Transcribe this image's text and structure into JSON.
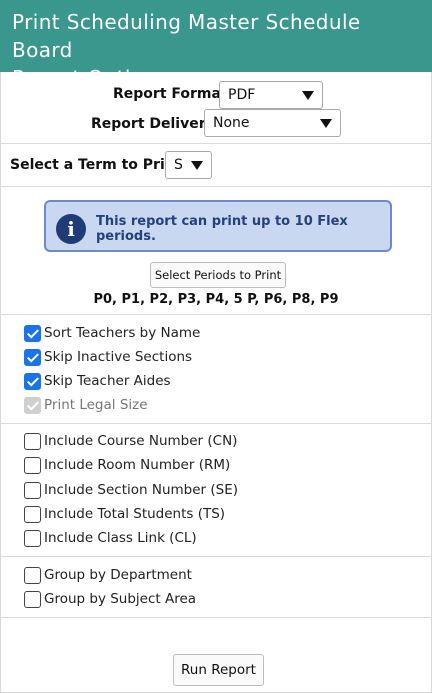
{
  "header": {
    "title_line1": "Print Scheduling Master Schedule Board",
    "title_line2": "Report Options"
  },
  "report": {
    "format_label": "Report Format:",
    "format_value": "PDF",
    "delivery_label": "Report Delivery:",
    "delivery_value": "None"
  },
  "term": {
    "label": "Select a Term to Print:",
    "value": "S"
  },
  "info": {
    "icon": "info-icon",
    "message": "This report can print up to 10 Flex periods."
  },
  "periods": {
    "button_label": "Select Periods to Print",
    "selected": "P0, P1, P2, P3, P4, 5 P, P6, P8, P9"
  },
  "options_group1": [
    {
      "label": "Sort Teachers by Name",
      "checked": true,
      "disabled": false
    },
    {
      "label": "Skip Inactive Sections",
      "checked": true,
      "disabled": false
    },
    {
      "label": "Skip Teacher Aides",
      "checked": true,
      "disabled": false
    },
    {
      "label": "Print Legal Size",
      "checked": true,
      "disabled": true
    }
  ],
  "options_group2": [
    {
      "label": "Include Course Number (CN)",
      "checked": false
    },
    {
      "label": "Include Room Number (RM)",
      "checked": false
    },
    {
      "label": "Include Section Number (SE)",
      "checked": false
    },
    {
      "label": "Include Total Students (TS)",
      "checked": false
    },
    {
      "label": "Include Class Link (CL)",
      "checked": false
    }
  ],
  "options_group3": [
    {
      "label": "Group by Department",
      "checked": false
    },
    {
      "label": "Group by Subject Area",
      "checked": false
    }
  ],
  "footer": {
    "run_label": "Run Report"
  },
  "colors": {
    "header_bg": "#3a978d",
    "checkbox_checked": "#1a73e8",
    "info_bg": "#c9d7f1"
  }
}
